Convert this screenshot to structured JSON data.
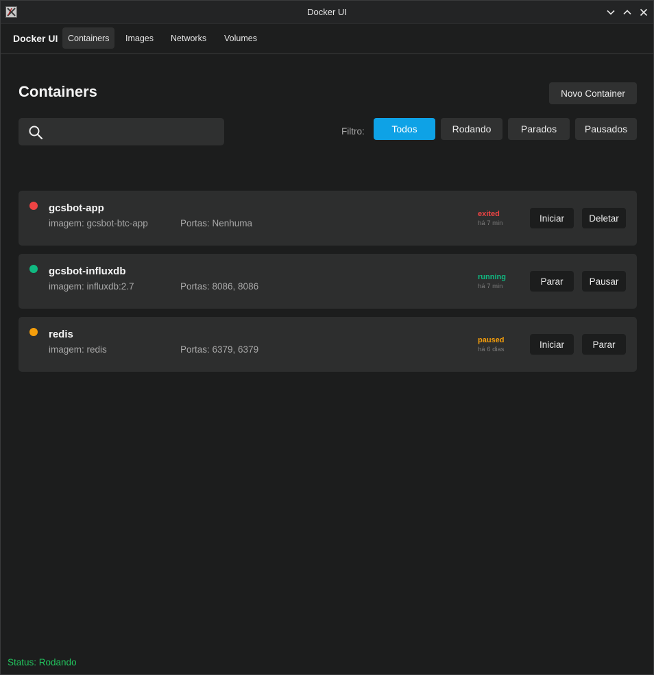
{
  "window": {
    "title": "Docker UI"
  },
  "nav": {
    "brand": "Docker UI",
    "tabs": [
      {
        "label": "Containers",
        "active": true
      },
      {
        "label": "Images",
        "active": false
      },
      {
        "label": "Networks",
        "active": false
      },
      {
        "label": "Volumes",
        "active": false
      }
    ]
  },
  "header": {
    "title": "Containers",
    "new_button": "Novo Container"
  },
  "search": {
    "value": "",
    "placeholder": ""
  },
  "filter": {
    "label": "Filtro:",
    "options": [
      "Todos",
      "Rodando",
      "Parados",
      "Pausados"
    ],
    "selected": "Todos"
  },
  "containers": [
    {
      "name": "gcsbot-app",
      "image": "imagem: gcsbot-btc-app",
      "ports": "Portas: Nenhuma",
      "state": "exited",
      "time": "há 7 min",
      "dot_color": "#ef4444",
      "state_color": "#ef4444",
      "actions": [
        "Iniciar",
        "Deletar"
      ]
    },
    {
      "name": "gcsbot-influxdb",
      "image": "imagem: influxdb:2.7",
      "ports": "Portas: 8086, 8086",
      "state": "running",
      "time": "há 7 min",
      "dot_color": "#10b981",
      "state_color": "#10b981",
      "actions": [
        "Parar",
        "Pausar"
      ]
    },
    {
      "name": "redis",
      "image": "imagem: redis",
      "ports": "Portas: 6379, 6379",
      "state": "paused",
      "time": "há 6 dias",
      "dot_color": "#f59e0b",
      "state_color": "#f59e0b",
      "actions": [
        "Iniciar",
        "Parar"
      ]
    }
  ],
  "status": {
    "text": "Status: Rodando",
    "color": "#22c55e"
  },
  "colors": {
    "accent": "#0ea2e6",
    "background": "#1c1d1d",
    "card": "#2d2e2e"
  },
  "icons": {
    "app": "x11-app-icon",
    "minimize": "chevron-down-icon",
    "maximize": "chevron-up-icon",
    "close": "close-icon",
    "search": "search-icon"
  }
}
